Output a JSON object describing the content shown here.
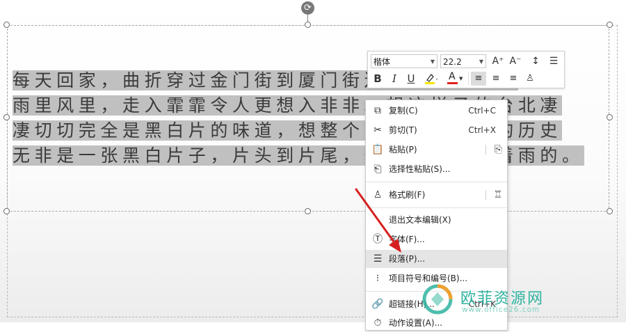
{
  "document": {
    "lines": [
      "每天回家，曲折穿过金门街到厦门街迷宫式的长巷，",
      "雨里风里，走入霏霏令人更想入非非。想这样子的台北凄",
      "凄切切完全是黑白片的味道，想整个中国整部中国的历史",
      "无非是一张黑白片子，片头到片尾，一直是这样下着雨的。"
    ]
  },
  "mini_toolbar": {
    "font_name": "楷体",
    "font_size": "22.2",
    "grow_font": "A⁺",
    "shrink_font": "A⁻",
    "bold": "B",
    "italic": "I",
    "underline": "U",
    "font_color_letter": "A",
    "highlight_color": "#f5e400",
    "font_color": "#e02020"
  },
  "context_menu": {
    "items": [
      {
        "label": "复制(C)",
        "shortcut": "Ctrl+C",
        "icon": "copy-icon"
      },
      {
        "label": "剪切(T)",
        "shortcut": "Ctrl+X",
        "icon": "cut-icon"
      },
      {
        "label": "粘贴(P)",
        "shortcut": "",
        "icon": "paste-icon"
      },
      {
        "label": "选择性粘贴(S)...",
        "shortcut": "",
        "icon": "paste-special-icon"
      },
      {
        "label": "格式刷(F)",
        "shortcut": "",
        "icon": "format-painter-icon"
      },
      {
        "label": "退出文本编辑(X)",
        "shortcut": "",
        "icon": ""
      },
      {
        "label": "字体(F)...",
        "shortcut": "",
        "icon": "font-icon"
      },
      {
        "label": "段落(P)...",
        "shortcut": "",
        "icon": "paragraph-icon"
      },
      {
        "label": "项目符号和编号(B)...",
        "shortcut": "",
        "icon": "bullets-icon"
      },
      {
        "label": "超链接(H)...",
        "shortcut": "Ctrl+K",
        "icon": "hyperlink-icon"
      },
      {
        "label": "动作设置(A)...",
        "shortcut": "",
        "icon": "action-icon"
      }
    ]
  },
  "annotation": {
    "arrow_color": "#d62020"
  },
  "watermark": {
    "title": "欧菲资源网",
    "url": "www.office26.com",
    "color": "#2fb3a0"
  }
}
